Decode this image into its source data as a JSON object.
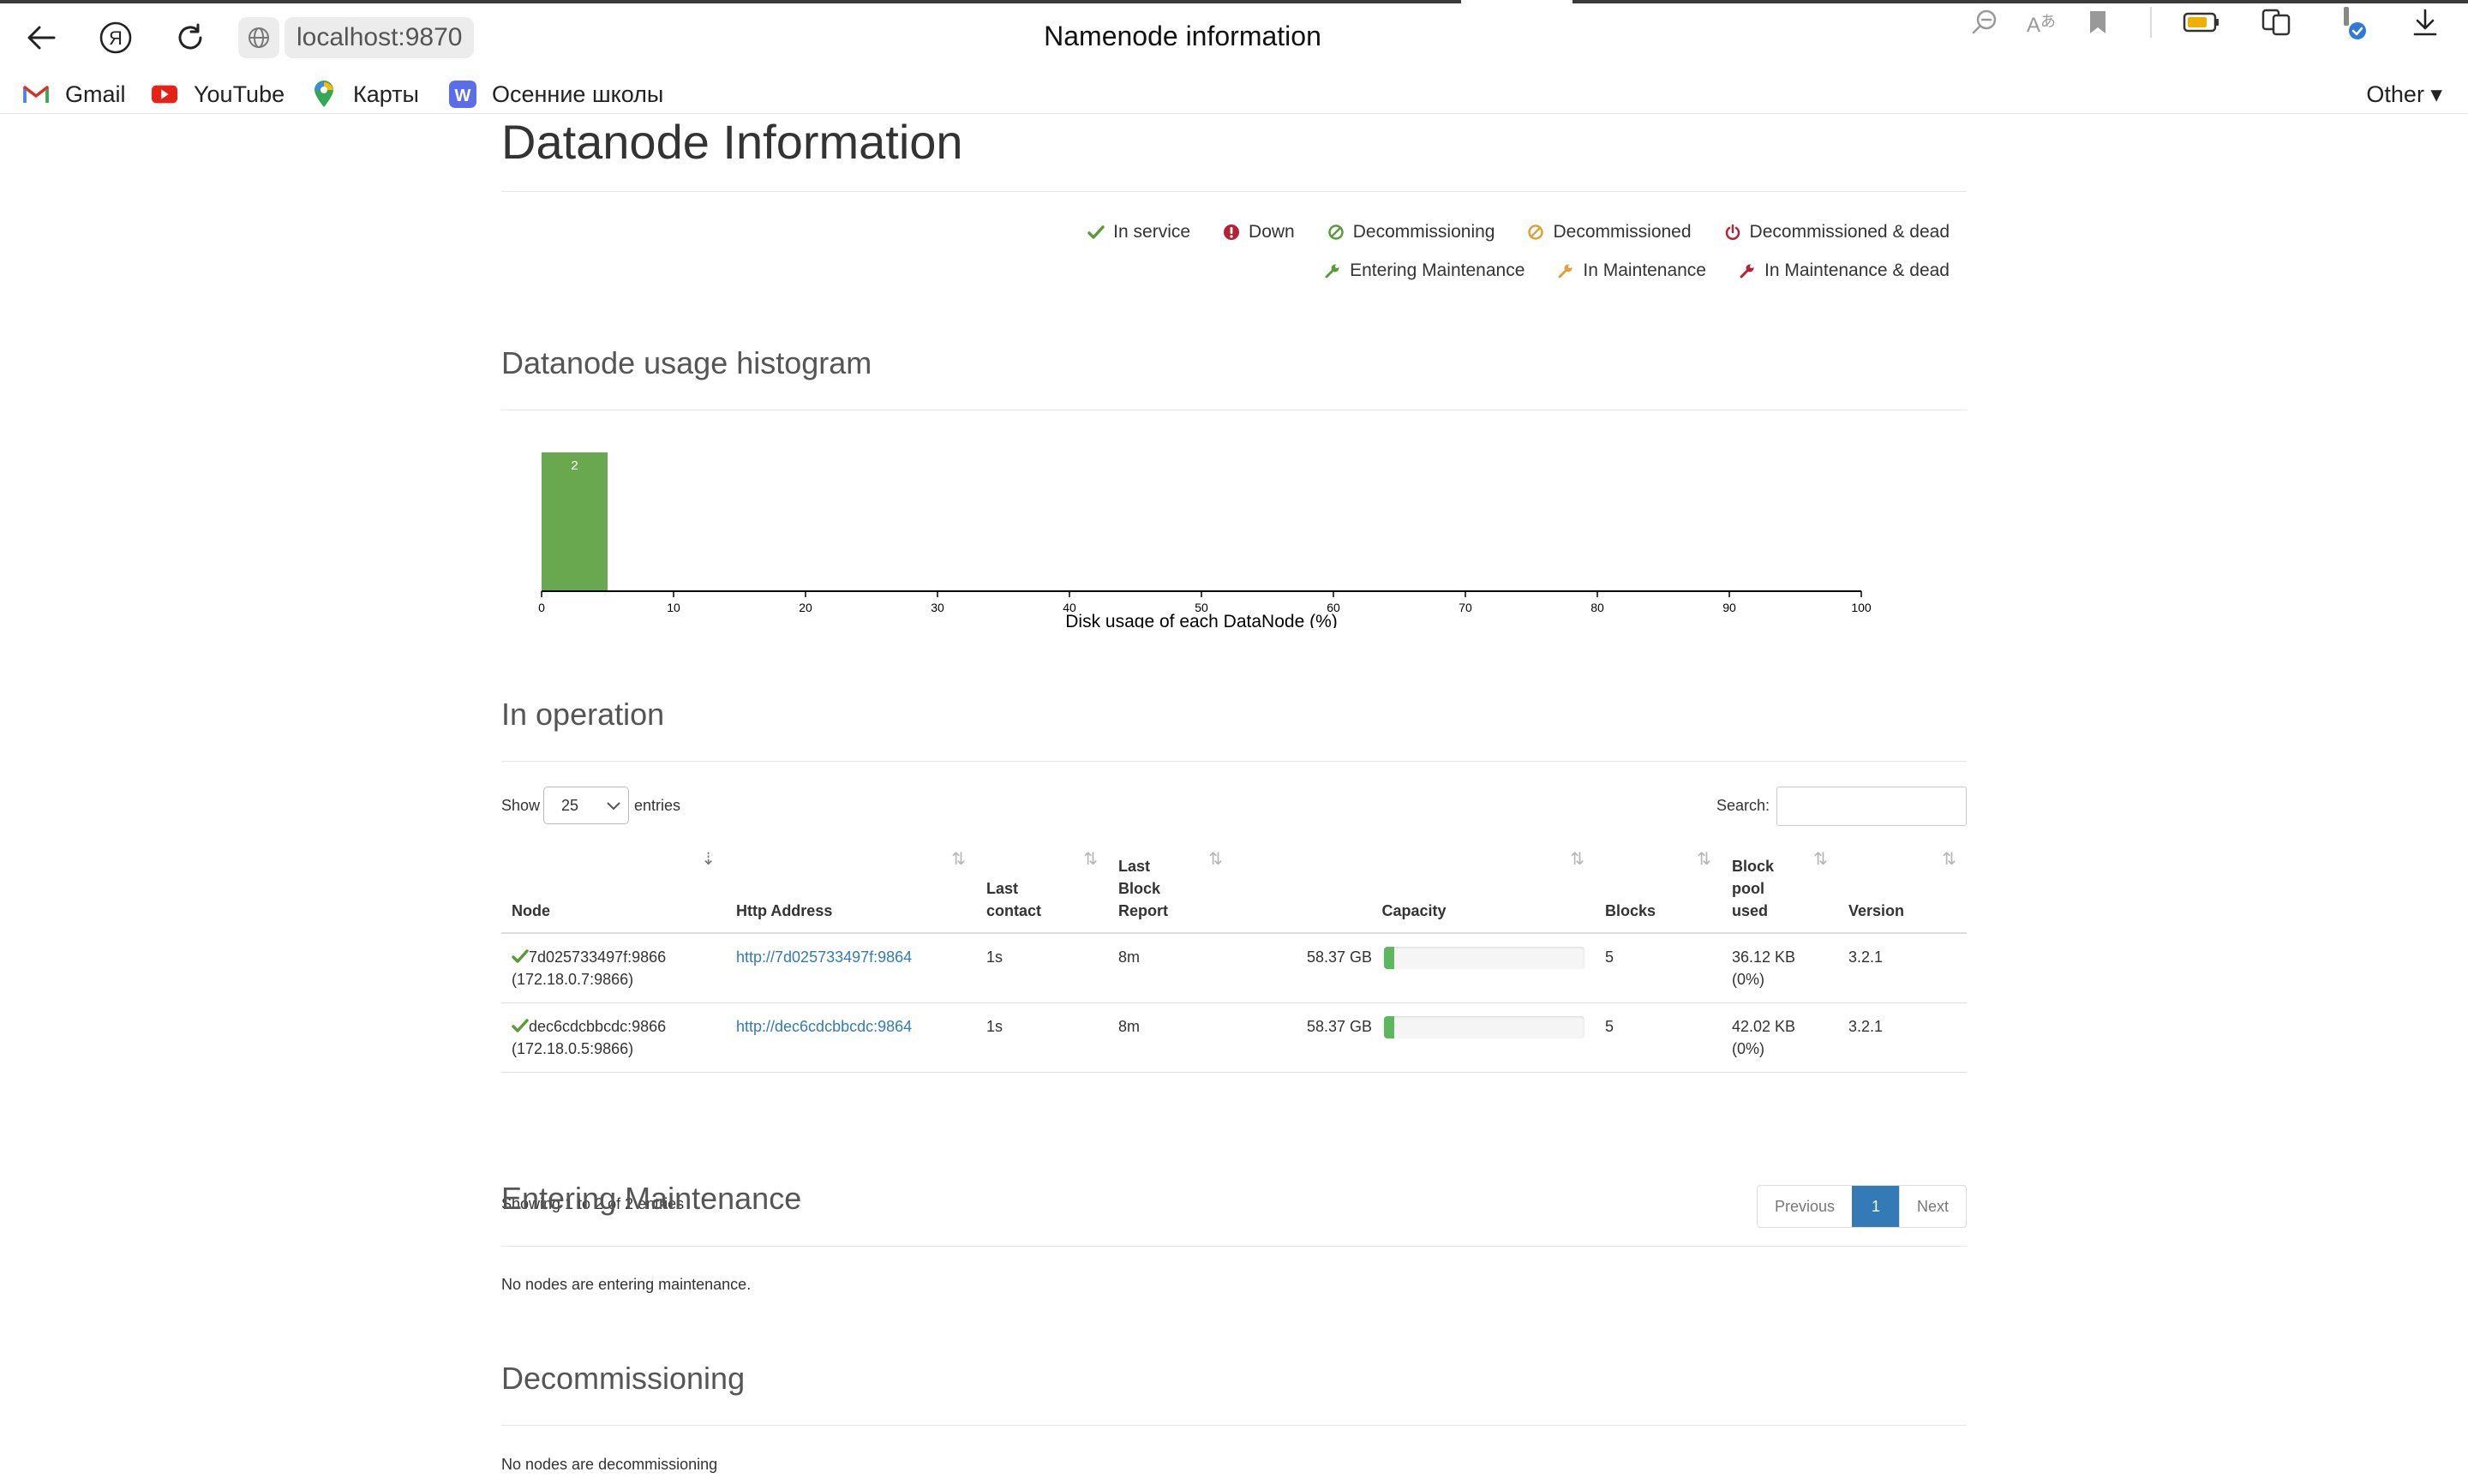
{
  "browser": {
    "url": "localhost:9870",
    "tab_title": "Namenode information",
    "bookmarks": [
      {
        "label": "Gmail",
        "icon": "gmail-icon"
      },
      {
        "label": "YouTube",
        "icon": "youtube-icon"
      },
      {
        "label": "Карты",
        "icon": "maps-icon"
      },
      {
        "label": "Осенние школы",
        "icon": "w-icon"
      }
    ],
    "bookmarks_other": "Other ▾"
  },
  "page": {
    "title": "Datanode Information",
    "legend": {
      "row1": [
        "In service",
        "Down",
        "Decommissioning",
        "Decommissioned",
        "Decommissioned & dead"
      ],
      "row2": [
        "Entering Maintenance",
        "In Maintenance",
        "In Maintenance & dead"
      ]
    },
    "histogram_title": "Datanode usage histogram",
    "in_operation_title": "In operation",
    "show_label": "Show",
    "entries_label": "entries",
    "page_size": "25",
    "search_label": "Search:",
    "table": {
      "headers": {
        "node": "Node",
        "http": "Http Address",
        "last_contact_1": "Last",
        "last_contact_2": "contact",
        "last_block_1": "Last",
        "last_block_2": "Block",
        "last_block_3": "Report",
        "capacity": "Capacity",
        "blocks": "Blocks",
        "bpu_1": "Block",
        "bpu_2": "pool",
        "bpu_3": "used",
        "version": "Version"
      },
      "rows": [
        {
          "node": "7d025733497f:9866",
          "node_ip": "(172.18.0.7:9866)",
          "http": "http://7d025733497f:9864",
          "last_contact": "1s",
          "last_block": "8m",
          "capacity": "58.37 GB",
          "capacity_used_fraction": 0.05,
          "blocks": "5",
          "bpu": "36.12 KB",
          "bpu_pct": "(0%)",
          "version": "3.2.1"
        },
        {
          "node": "dec6cdcbbcdc:9866",
          "node_ip": "(172.18.0.5:9866)",
          "http": "http://dec6cdcbbcdc:9864",
          "last_contact": "1s",
          "last_block": "8m",
          "capacity": "58.37 GB",
          "capacity_used_fraction": 0.05,
          "blocks": "5",
          "bpu": "42.02 KB",
          "bpu_pct": "(0%)",
          "version": "3.2.1"
        }
      ]
    },
    "showing": "Showing 1 to 2 of 2 entries",
    "pager": {
      "previous": "Previous",
      "current": "1",
      "next": "Next"
    },
    "entering_maintenance_title": "Entering Maintenance",
    "entering_maintenance_msg": "No nodes are entering maintenance.",
    "decommissioning_title": "Decommissioning",
    "decommissioning_msg": "No nodes are decommissioning"
  },
  "colors": {
    "in_service": "#5a9a3a",
    "down": "#b22234",
    "decom": "#e0a03a",
    "bar": "#6aa84f"
  },
  "chart_data": {
    "type": "bar",
    "x": [
      0,
      5
    ],
    "values": [
      2
    ],
    "bin_width": 5,
    "bins": [
      {
        "start": 0,
        "end": 5,
        "count": 2
      }
    ],
    "xlabel": "Disk usage of each DataNode (%)",
    "xlim": [
      0,
      100
    ],
    "xticks": [
      "0",
      "10",
      "20",
      "30",
      "40",
      "50",
      "60",
      "70",
      "80",
      "90",
      "100"
    ],
    "bar_labels": [
      "2"
    ],
    "grid": false
  }
}
